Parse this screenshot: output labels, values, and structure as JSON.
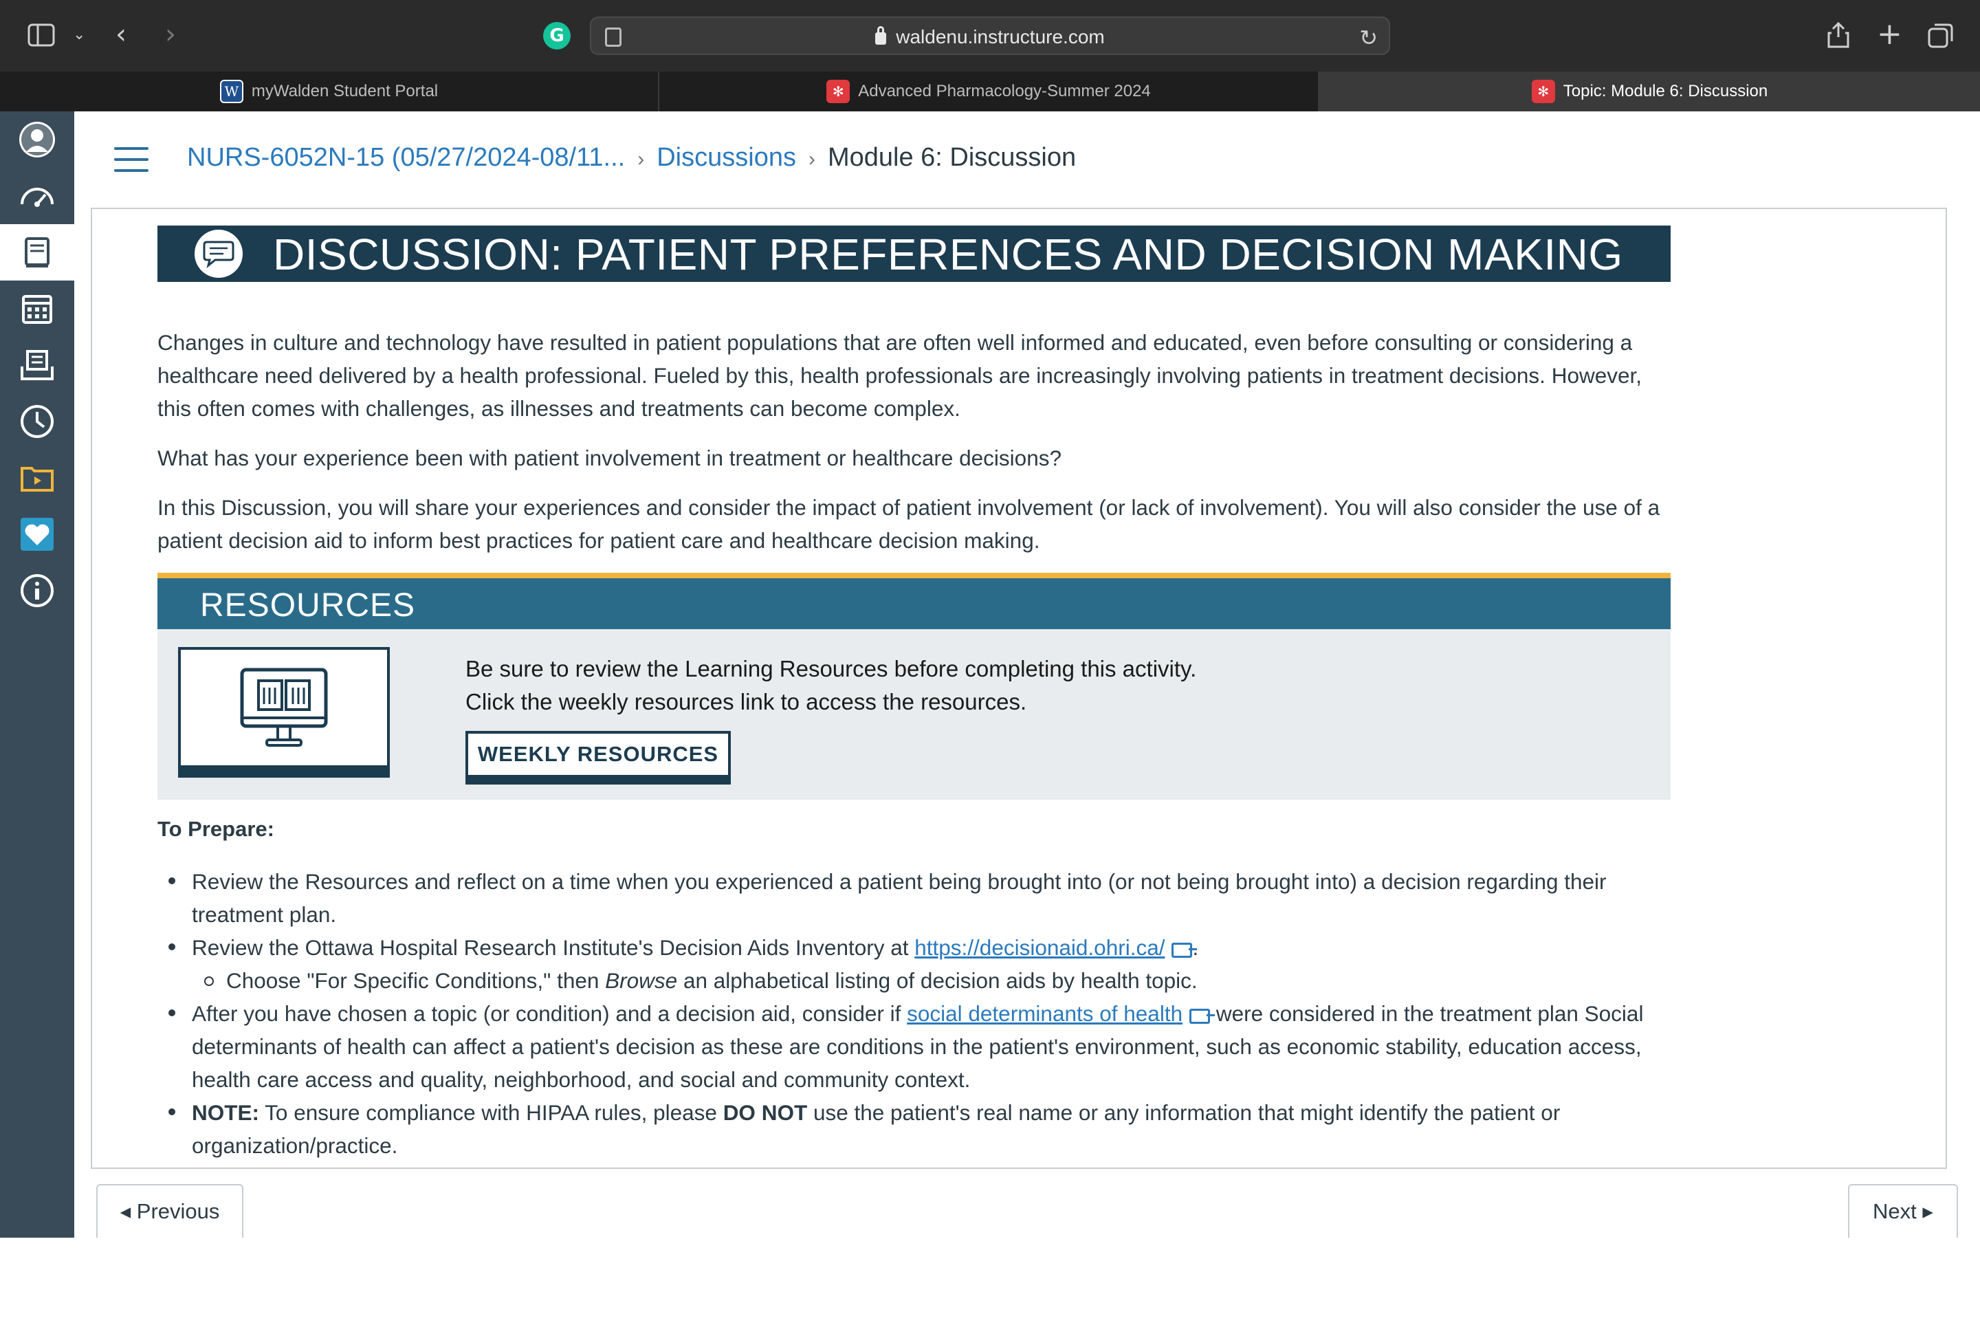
{
  "browser": {
    "url": "waldenu.instructure.com",
    "tabs": [
      {
        "label": "myWalden Student Portal",
        "favicon": "walden-w-icon"
      },
      {
        "label": "Advanced Pharmacology-Summer 2024",
        "favicon": "canvas-icon"
      },
      {
        "label": "Topic: Module 6: Discussion",
        "favicon": "canvas-icon"
      }
    ],
    "active_tab": 2,
    "grammarly_letter": "G"
  },
  "breadcrumb": {
    "course": "NURS-6052N-15 (05/27/2024-08/11...",
    "section": "Discussions",
    "current": "Module 6: Discussion",
    "separator": "›"
  },
  "banner": {
    "title": "DISCUSSION: PATIENT PREFERENCES AND DECISION MAKING"
  },
  "intro": {
    "p1": "Changes in culture and technology have resulted in patient populations that are often well informed and educated, even before consulting or considering a healthcare need delivered by a health professional. Fueled by this, health professionals are increasingly involving patients in treatment decisions. However, this often comes with challenges, as illnesses and treatments can become complex.",
    "p2": "What has your experience been with patient involvement in treatment or healthcare decisions?",
    "p3": "In this Discussion, you will share your experiences and consider the impact of patient involvement (or lack of involvement). You will also consider the use of a patient decision aid to inform best practices for patient care and healthcare decision making."
  },
  "resources": {
    "title": "RESOURCES",
    "line1": "Be sure to review the Learning Resources before completing this activity.",
    "line2": "Click the weekly resources link to access the resources.",
    "button": "WEEKLY RESOURCES"
  },
  "prepare": {
    "heading": "To Prepare:",
    "item1": "Review the Resources and reflect on a time when you experienced a patient being brought into (or not being brought into) a decision regarding their treatment plan.",
    "item2_pre": "Review the Ottawa Hospital Research Institute's Decision Aids Inventory at ",
    "item2_link": "https://decisionaid.ohri.ca/",
    "item2_post": ".",
    "sub1_pre": "Choose \"For Specific Conditions,\" then ",
    "sub1_em": "Browse",
    "sub1_post": " an alphabetical listing of decision aids by health topic.",
    "item3_pre": "After you have chosen a topic (or condition) and a decision aid, consider if ",
    "item3_link": "social determinants of health",
    "item3_post": " were considered in the treatment plan Social determinants of health can affect a patient's decision as these are conditions in the patient's environment, such as economic stability, education access, health care access and quality, neighborhood, and social and community context.",
    "item4_label": "NOTE:",
    "item4_pre": " To ensure compliance with HIPAA rules, please ",
    "item4_bold": "DO NOT",
    "item4_post": " use the patient's real name or any information that might identify the patient or organization/practice."
  },
  "footer": {
    "previous": "◂ Previous",
    "next": "Next ▸"
  },
  "colors": {
    "nav_bg": "#394b58",
    "banner_bg": "#1c3c50",
    "resources_bg": "#2a6b8a",
    "accent_gold": "#f0b43c",
    "link": "#2b7abc"
  }
}
